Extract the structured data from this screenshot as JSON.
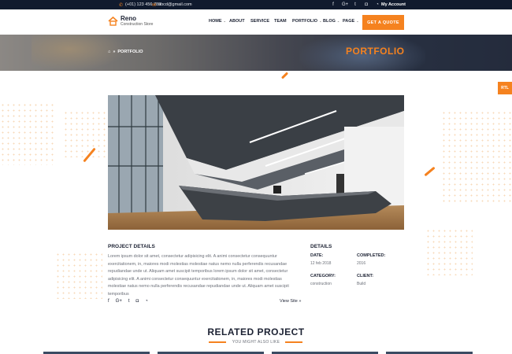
{
  "topbar": {
    "phone": "(+01) 123 456 789",
    "email": "abcd@gmail.com",
    "social": [
      "facebook-icon",
      "google-plus-icon",
      "twitter-icon",
      "instagram-icon",
      "rss-icon"
    ],
    "account": "My Account"
  },
  "brand": {
    "name": "Reno",
    "tagline": "Construction Store"
  },
  "nav": [
    {
      "label": "HOME",
      "has_dropdown": true
    },
    {
      "label": "ABOUT",
      "has_dropdown": false
    },
    {
      "label": "SERVICE",
      "has_dropdown": false
    },
    {
      "label": "TEAM",
      "has_dropdown": false
    },
    {
      "label": "PORTFOLIO",
      "has_dropdown": true
    },
    {
      "label": "BLOG",
      "has_dropdown": true
    },
    {
      "label": "PAGE",
      "has_dropdown": true
    }
  ],
  "quote_button": "GET A QUOTE",
  "banner": {
    "crumb_home_icon": "home-icon",
    "crumb_sep": "»",
    "crumb_current": "PORTFOLIO",
    "title": "PORTFOLIO"
  },
  "rtl_label": "RTL",
  "project_details": {
    "title": "PROJECT DETAILS",
    "text": "Lorem ipsum dolor sit amet, consectetur adipisicing elit. A animi consectetur consequuntur exercitationem, in, maiores modi molestias molestiae natus nemo nulla perferendis recusandae repudiandae unde ut. Aliquam amet suscipit temporibus lorem ipsum dolor sit amet, consectetur adipisicing elit. A animi consectetur consequuntur exercitationem, in, maiores modi molestias molestiae natus nemo nulla perferendis recusandae repudiandae unde ut. Aliquam amet suscipit temporibus",
    "share_icons": [
      "facebook-icon",
      "google-plus-icon",
      "twitter-icon",
      "instagram-icon",
      "rss-icon"
    ],
    "view_site": "View Site »"
  },
  "details": {
    "title": "DETAILS",
    "date_label": "DATE:",
    "date_value": "12 feb 2018",
    "completed_label": "COMPLETED:",
    "completed_value": "2016",
    "category_label": "CATEGORY:",
    "category_value": "construction",
    "client_label": "CLIENT:",
    "client_value": "Build"
  },
  "related": {
    "title": "RELATED PROJECT",
    "subtitle": "YOU MIGHT ALSO LIKE"
  },
  "colors": {
    "accent": "#f5821f",
    "topbar": "#101a2e",
    "heading": "#1c2233",
    "body_text": "#6b6f78"
  }
}
